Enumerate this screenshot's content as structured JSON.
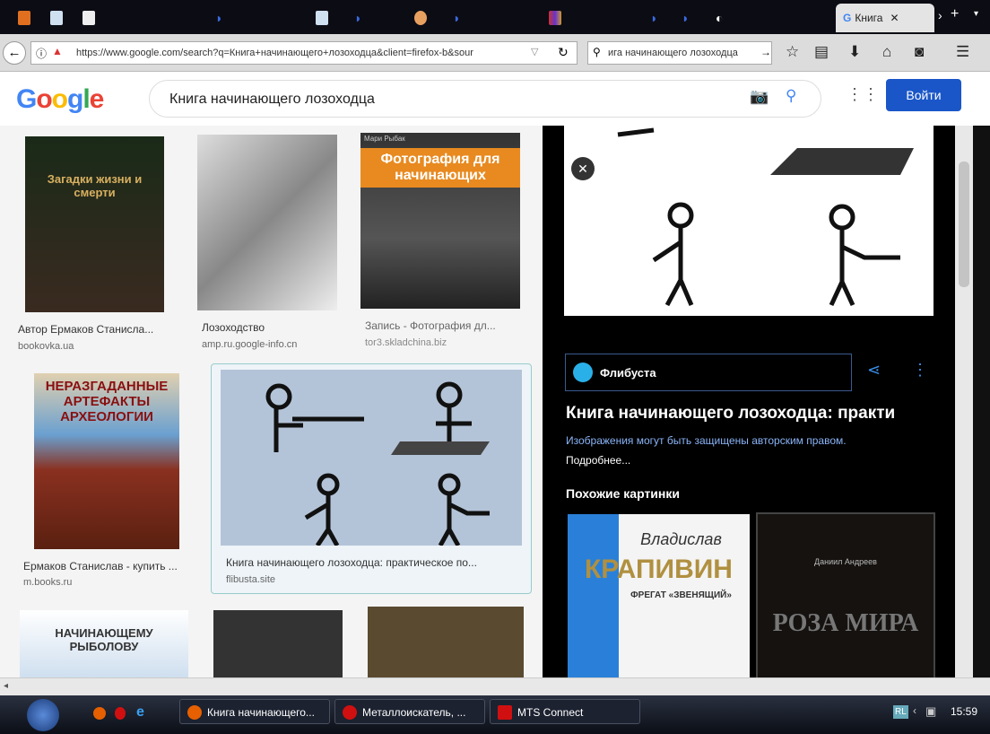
{
  "browser": {
    "tab_title": "Книга",
    "url": "https://www.google.com/search?q=Книга+начинающего+лозоходца&client=firefox-b&sour",
    "search_box": "ига начинающего лозоходца"
  },
  "google": {
    "logo": "Google",
    "query": "Книга начинающего лозоходца",
    "login": "Войти"
  },
  "results": [
    {
      "caption": "Автор Ермаков Станисла...",
      "source": "bookovka.ua",
      "cover": "Загадки жизни и смерти"
    },
    {
      "caption": "Лозоходство",
      "source": "amp.ru.google-info.cn"
    },
    {
      "caption": "Запись - Фотография дл...",
      "source": "tor3.skladchina.biz",
      "cover": "Фотография для начинающих",
      "cover_author": "Мари Рыбак"
    },
    {
      "caption": "Ермаков Станислав - купить ...",
      "source": "m.books.ru",
      "cover": "НЕРАЗГАДАННЫЕ АРТЕФАКТЫ АРХЕОЛОГИИ"
    },
    {
      "caption": "Книга начинающего лозоходца: практическое по...",
      "source": "flibusta.site"
    },
    {
      "cover": "НАЧИНАЮЩЕМУ РЫБОЛОВУ"
    }
  ],
  "panel": {
    "site": "Флибуста",
    "title": "Книга начинающего лозоходца: практи",
    "notice": "Изображения могут быть защищены авторским правом.",
    "more": "Подробнее...",
    "similar_heading": "Похожие картинки",
    "similar": [
      {
        "author": "Владислав",
        "title": "КРАПИВИН",
        "subtitle": "ФРЕГАТ «ЗВЕНЯЩИЙ»"
      },
      {
        "author": "Даниил Андреев",
        "title": "РОЗА МИРА"
      }
    ]
  },
  "taskbar": {
    "tasks": [
      "Книга начинающего...",
      "Металлоискатель, ...",
      "MTS Connect"
    ],
    "lang": "RL",
    "clock": "15:59"
  }
}
